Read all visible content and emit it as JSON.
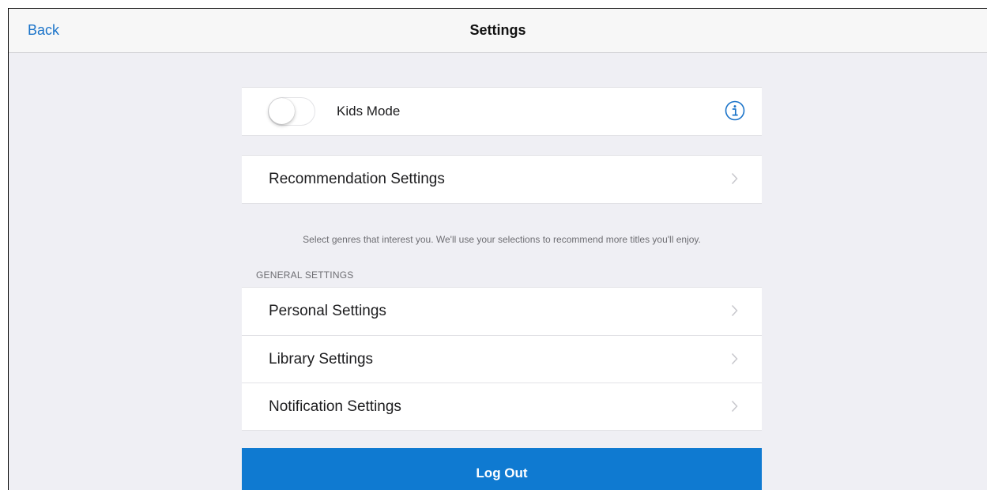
{
  "navbar": {
    "back_label": "Back",
    "title": "Settings"
  },
  "kids_mode": {
    "label": "Kids Mode",
    "enabled": false
  },
  "recommendation": {
    "label": "Recommendation Settings",
    "helper_text": "Select genres that interest you. We'll use your selections to recommend more titles you'll enjoy."
  },
  "general": {
    "header": "GENERAL SETTINGS",
    "items": [
      {
        "label": "Personal Settings"
      },
      {
        "label": "Library Settings"
      },
      {
        "label": "Notification Settings"
      }
    ]
  },
  "logout": {
    "label": "Log Out"
  },
  "colors": {
    "accent": "#1a73c9",
    "logout_bg": "#0f7ad1",
    "background": "#efeff4"
  }
}
